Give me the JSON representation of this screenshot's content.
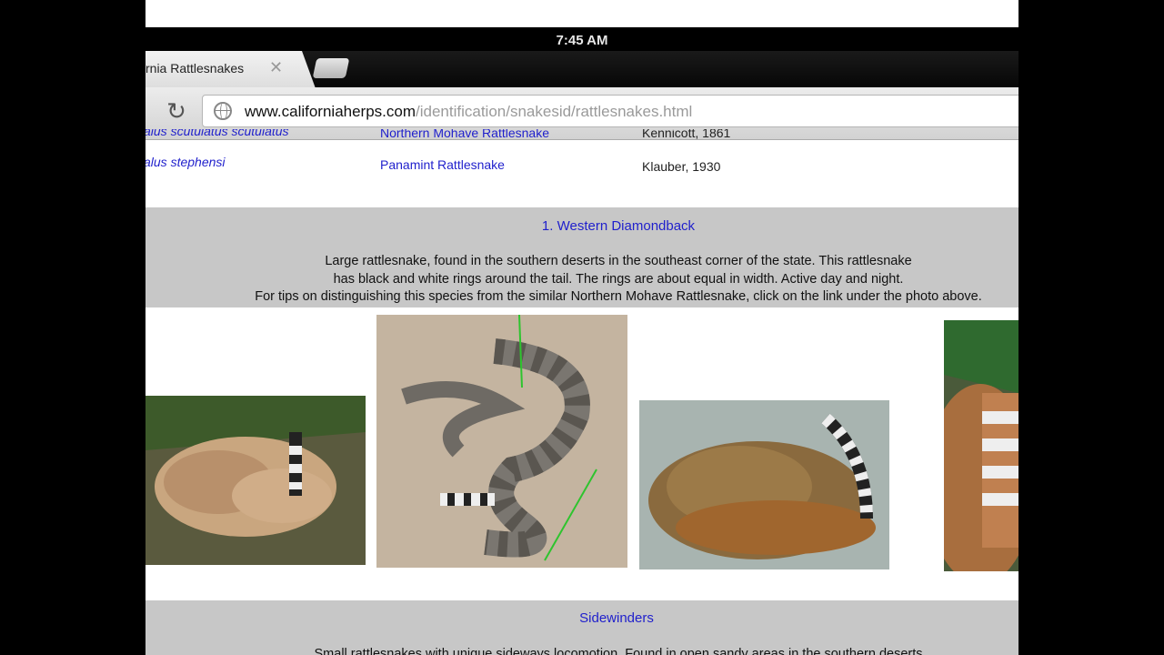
{
  "status": {
    "time": "7:45 AM"
  },
  "browser": {
    "tab_title": "rnia Rattlesnakes",
    "url_host": "www.californiaherps.com",
    "url_path": "/identification/snakesid/rattlesnakes.html"
  },
  "table_rows": [
    {
      "scientific": "alus scutulatus scutulatus",
      "common": "Northern Mohave Rattlesnake",
      "author": "Kennicott, 1861"
    },
    {
      "scientific": "alus stephensi",
      "common": "Panamint Rattlesnake",
      "author": "Klauber, 1930"
    }
  ],
  "section1": {
    "title": "1. Western Diamondback",
    "lines": [
      "Large rattlesnake, found in the southern deserts in the southeast corner of the state. This rattlesnake",
      "has black and white rings around the tail. The rings are about equal in width. Active day and night.",
      "For tips on distinguishing this species from the similar Northern Mohave Rattlesnake, click on the link under the photo above."
    ]
  },
  "section2": {
    "title": "Sidewinders",
    "line": "Small rattlesnakes with unique sideways locomotion. Found in open sandy areas in the southern deserts"
  }
}
